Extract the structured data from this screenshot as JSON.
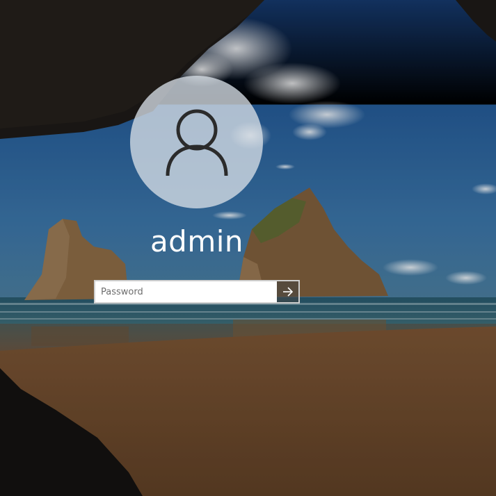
{
  "wallpaper": {
    "scene": "beach-cave-sea-stacks",
    "colors": {
      "sky_top": "#163a6a",
      "sky_mid": "#2e66a3",
      "sky_horizon": "#3a6f9c",
      "sea": "#2f6f86",
      "sand": "#7a5535",
      "rock_dark": "#1c1a17",
      "stack_rock": "#8c6b45"
    }
  },
  "user": {
    "avatar_icon": "user-silhouette-icon",
    "name": "admin"
  },
  "password": {
    "placeholder": "Password",
    "value": ""
  },
  "submit": {
    "icon": "arrow-right-icon"
  },
  "colors": {
    "avatar_bg": "#d6dee6",
    "input_border": "#cfcfcf",
    "submit_bg": "#464646",
    "text": "#ffffff"
  }
}
